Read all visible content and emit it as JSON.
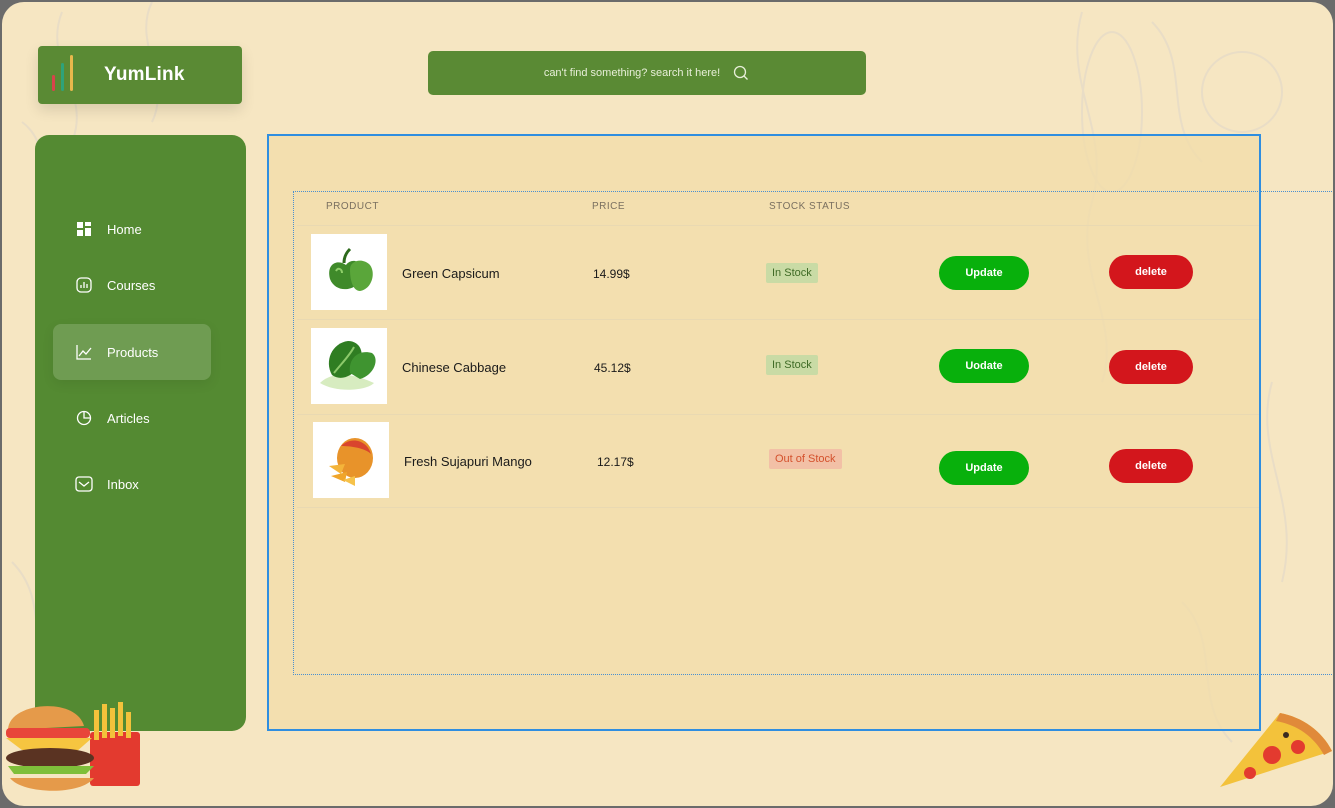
{
  "app": {
    "title": "YumLink"
  },
  "logo_colors": [
    "#d9434b",
    "#2ea37a",
    "#e7b84c"
  ],
  "search": {
    "placeholder_text": "can't find something? search it here!",
    "icon": "search-icon"
  },
  "sidebar": {
    "items": [
      {
        "label": "Home",
        "icon": "grid-icon",
        "active": false
      },
      {
        "label": "Courses",
        "icon": "chart-box-icon",
        "active": false
      },
      {
        "label": "Products",
        "icon": "line-chart-icon",
        "active": true
      },
      {
        "label": "Articles",
        "icon": "pie-chart-icon",
        "active": false
      },
      {
        "label": "Inbox",
        "icon": "inbox-icon",
        "active": false
      }
    ]
  },
  "table": {
    "headers": {
      "product": "PRODUCT",
      "price": "PRICE",
      "stock": "STOCK STATUS"
    },
    "rows": [
      {
        "name": "Green Capsicum",
        "price": "14.99$",
        "stock": "In Stock",
        "in_stock": true,
        "update_label": "Update",
        "delete_label": "delete"
      },
      {
        "name": "Chinese Cabbage",
        "price": "45.12$",
        "stock": "In Stock",
        "in_stock": true,
        "update_label": "Uodate",
        "delete_label": "delete"
      },
      {
        "name": "Fresh Sujapuri Mango",
        "price": "12.17$",
        "stock": "Out of Stock",
        "in_stock": false,
        "update_label": "Update",
        "delete_label": "delete"
      }
    ]
  },
  "colors": {
    "accent": "#548a32",
    "update": "#08b00c",
    "delete": "#d3161c",
    "background": "#f6e6c2"
  }
}
